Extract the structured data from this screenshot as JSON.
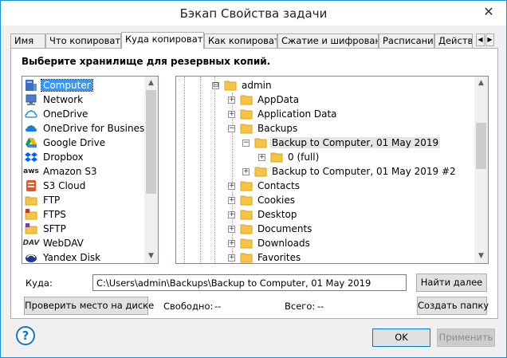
{
  "window": {
    "title": "Бэкап Свойства задачи",
    "close_glyph": "✕"
  },
  "tabs": [
    {
      "label": "Имя"
    },
    {
      "label": "Что копировать"
    },
    {
      "label": "Куда копировать"
    },
    {
      "label": "Как копировать"
    },
    {
      "label": "Сжатие и шифрование"
    },
    {
      "label": "Расписание"
    },
    {
      "label": "Действия"
    }
  ],
  "tab_scroll": {
    "left": "◀",
    "right": "▶"
  },
  "heading": "Выберите хранилище для резервных копий.",
  "storage": {
    "items": [
      {
        "label": "Computer",
        "icon": "computer-icon"
      },
      {
        "label": "Network",
        "icon": "network-icon"
      },
      {
        "label": "OneDrive",
        "icon": "onedrive-icon"
      },
      {
        "label": "OneDrive for Business",
        "icon": "onedrive-business-icon"
      },
      {
        "label": "Google Drive",
        "icon": "google-drive-icon"
      },
      {
        "label": "Dropbox",
        "icon": "dropbox-icon"
      },
      {
        "label": "Amazon S3",
        "icon": "aws-icon"
      },
      {
        "label": "S3 Cloud",
        "icon": "s3-cloud-icon"
      },
      {
        "label": "FTP",
        "icon": "ftp-folder-icon"
      },
      {
        "label": "FTPS",
        "icon": "ftps-folder-icon"
      },
      {
        "label": "SFTP",
        "icon": "sftp-folder-icon"
      },
      {
        "label": "WebDAV",
        "icon": "webdav-icon"
      },
      {
        "label": "Yandex Disk",
        "icon": "yandex-disk-icon"
      }
    ],
    "aws_text": "aws",
    "dav_text": "DAV"
  },
  "tree": {
    "items": [
      {
        "label": "admin",
        "expander": "⊟"
      },
      {
        "label": "AppData",
        "expander": "+"
      },
      {
        "label": "Application Data",
        "expander": "+"
      },
      {
        "label": "Backups",
        "expander": "−"
      },
      {
        "label": "Backup to Computer, 01 May 2019",
        "expander": "−"
      },
      {
        "label": "0 (full)",
        "expander": "+"
      },
      {
        "label": "Backup to Computer, 01 May 2019 #2",
        "expander": "+"
      },
      {
        "label": "Contacts",
        "expander": "+"
      },
      {
        "label": "Cookies",
        "expander": "+"
      },
      {
        "label": "Desktop",
        "expander": "+"
      },
      {
        "label": "Documents",
        "expander": "+"
      },
      {
        "label": "Downloads",
        "expander": "+"
      },
      {
        "label": "Favorites",
        "expander": "+"
      }
    ]
  },
  "scroll_arrows": {
    "up": "▲",
    "down": "▼"
  },
  "destination": {
    "label": "Куда:",
    "path": "C:\\Users\\admin\\Backups\\Backup to Computer, 01 May 2019",
    "find_next": "Найти далее"
  },
  "disk": {
    "check_button": "Проверить место на диске",
    "free_label": "Свободно:",
    "free_value": "--",
    "total_label": "Всего:",
    "total_value": "--",
    "create_folder": "Создать папку"
  },
  "footer": {
    "help": "?",
    "ok": "OK",
    "apply": "Применить"
  },
  "colors": {
    "accent": "#0078d7",
    "selection": "#3399ff",
    "folder": "#f6c445"
  }
}
